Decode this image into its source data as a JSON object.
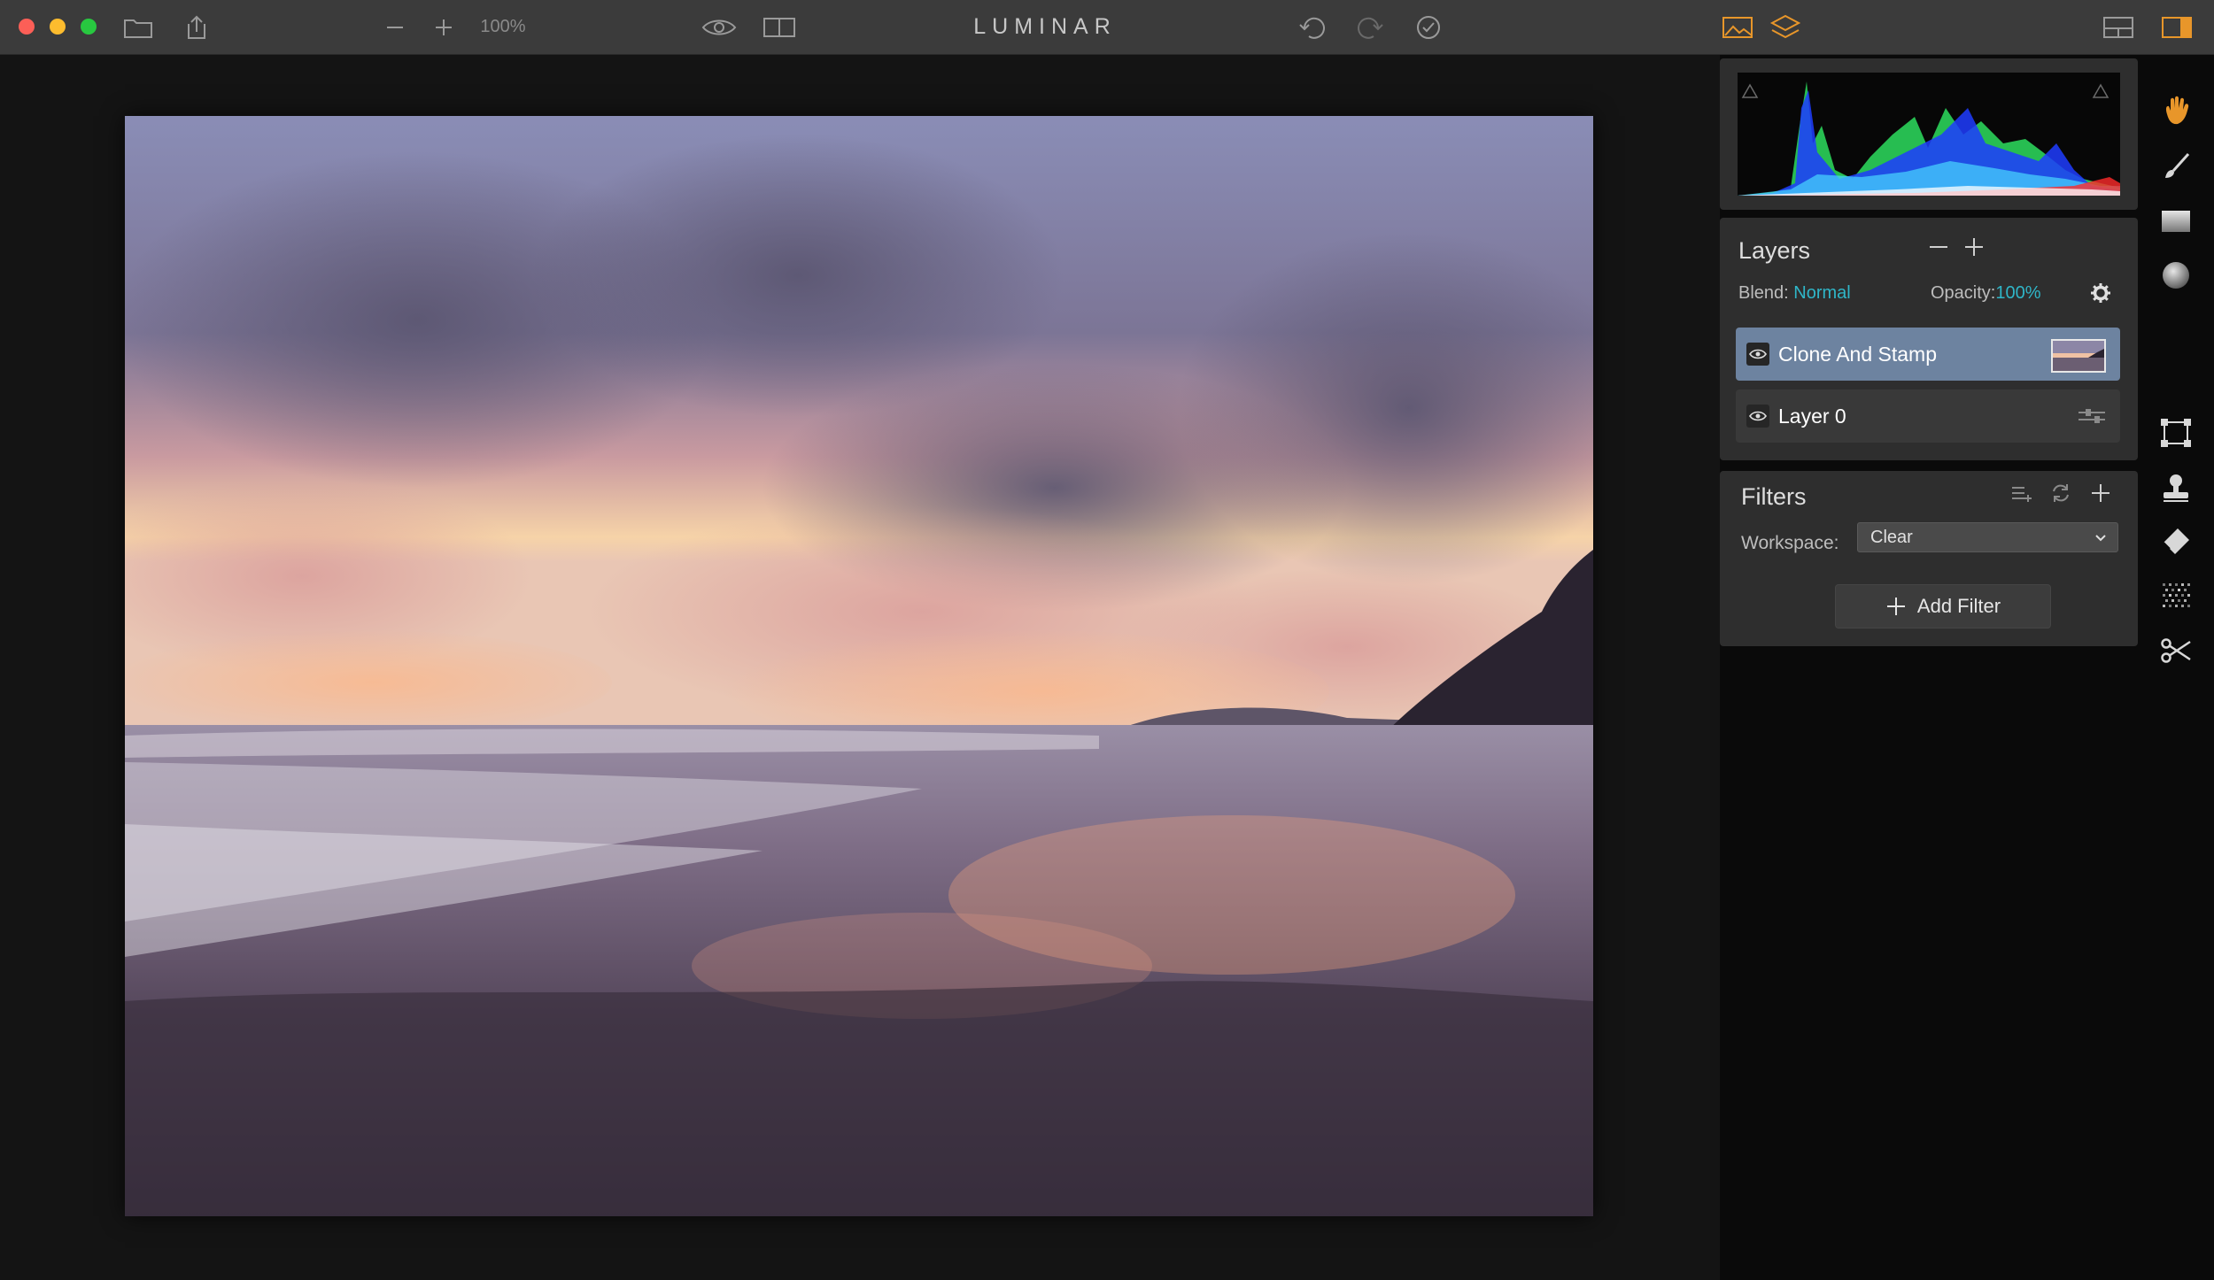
{
  "app": {
    "title": "LUMINAR"
  },
  "toolbar": {
    "zoom_level": "100%"
  },
  "colors": {
    "accent": "#2fb6c8",
    "active_layer": "#6d83a0",
    "orange_icon": "#e8962a"
  },
  "layers": {
    "title": "Layers",
    "blend_label": "Blend:",
    "blend_value": "Normal",
    "opacity_label": "Opacity:",
    "opacity_value": "100%",
    "items": [
      {
        "name": "Clone And Stamp",
        "active": true
      },
      {
        "name": "Layer 0",
        "active": false
      }
    ]
  },
  "filters": {
    "title": "Filters",
    "workspace_label": "Workspace:",
    "workspace_value": "Clear",
    "add_filter_label": "Add Filter"
  },
  "icons": {
    "toolbar": [
      "close-dot",
      "minimize-dot",
      "maximize-dot",
      "folder-icon",
      "share-icon",
      "zoom-out-icon",
      "zoom-in-icon",
      "eye-icon",
      "compare-icon",
      "undo-icon",
      "redo-icon",
      "check-history-icon",
      "image-view-icon",
      "layers-view-icon",
      "layout-icon",
      "side-panel-icon"
    ],
    "tools": [
      "hand-icon",
      "brush-icon",
      "gradient-icon",
      "radial-icon",
      "transform-icon",
      "clone-stamp-icon",
      "eraser-icon",
      "noise-icon",
      "crop-icon"
    ]
  }
}
